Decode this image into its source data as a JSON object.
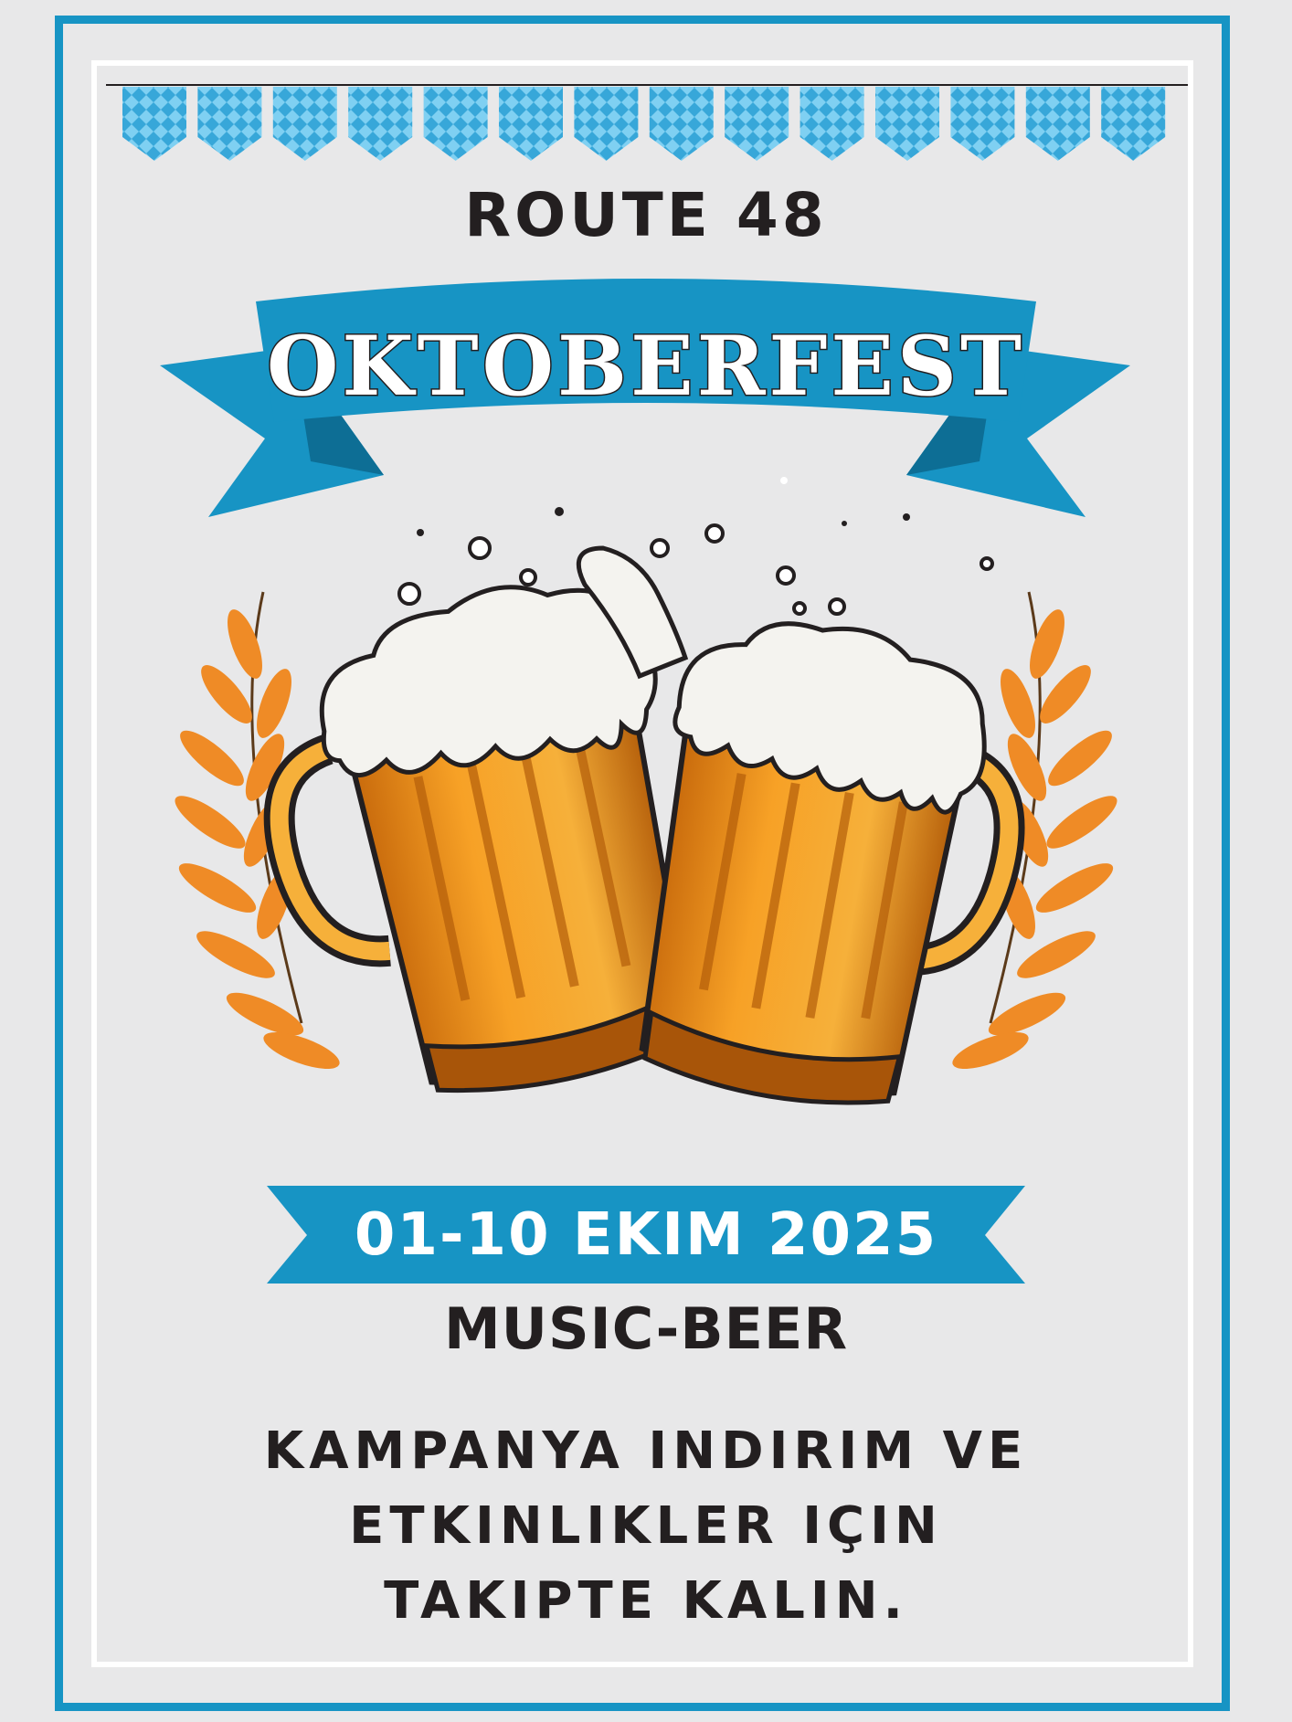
{
  "venue": "ROUTE 48",
  "event_title": "OKTOBERFEST",
  "date_range": "01-10 EKIM 2025",
  "subtitle": "MUSIC-BEER",
  "promo_text": "KAMPANYA INDIRIM VE ETKINLIKLER IÇIN TAKIPTE KALIN.",
  "colors": {
    "accent_blue": "#1794c4",
    "bunting_blue": "#4fb7e2",
    "background": "#e8e8e9",
    "beer_amber": "#f39a1e",
    "wheat_orange": "#ef8b26",
    "text_dark": "#231f20"
  },
  "icons": [
    "bunting-flags",
    "ribbon-banner",
    "beer-mugs-illustration",
    "wheat-left-icon",
    "wheat-right-icon"
  ]
}
